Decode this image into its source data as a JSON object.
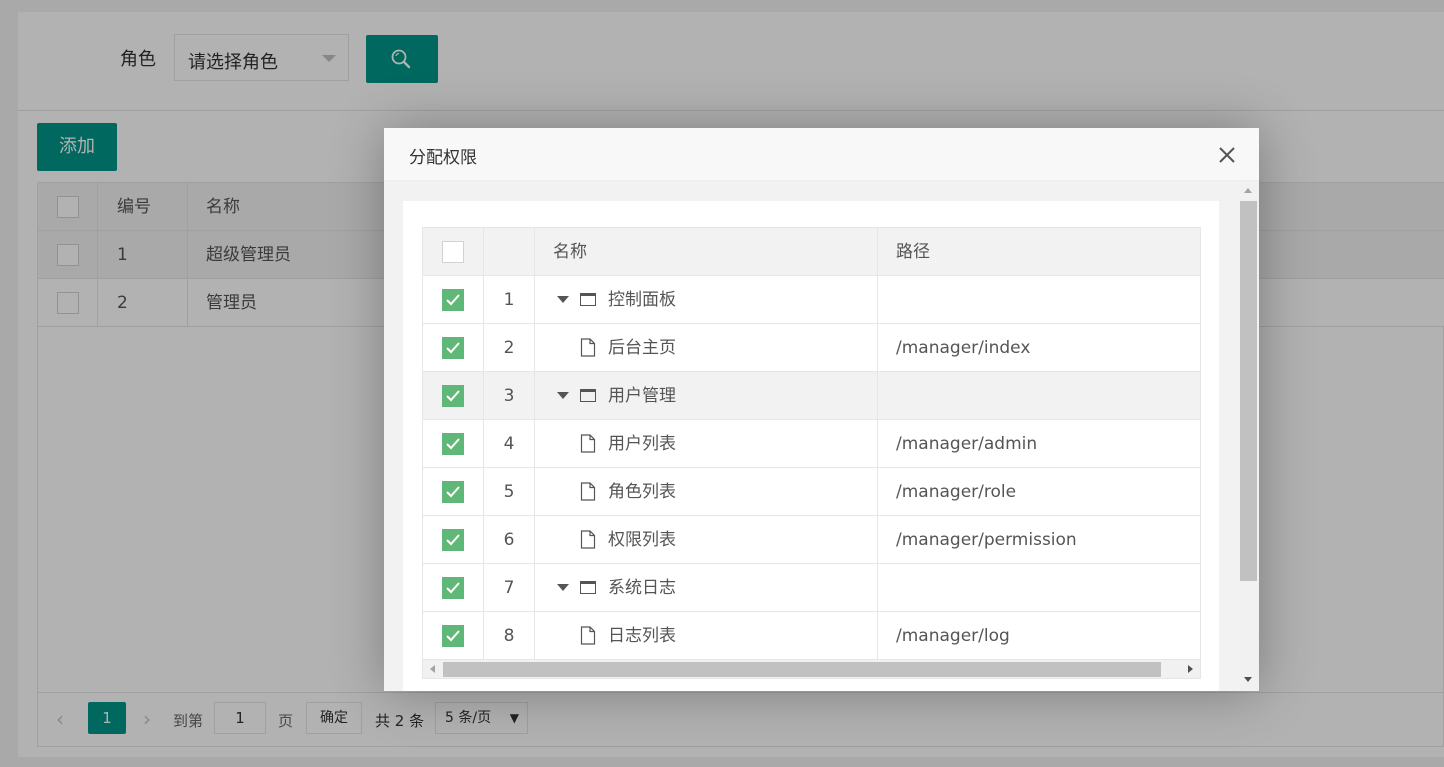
{
  "search": {
    "role_label": "角色",
    "role_select_value": "请选择角色",
    "search_button_icon": "search-icon"
  },
  "toolbar": {
    "add_label": "添加"
  },
  "roles_table": {
    "headers": {
      "number": "编号",
      "name": "名称"
    },
    "rows": [
      {
        "id": "1",
        "name": "超级管理员"
      },
      {
        "id": "2",
        "name": "管理员"
      }
    ]
  },
  "pager": {
    "current_page": "1",
    "goto_label": "到第",
    "page_input": "1",
    "page_unit": "页",
    "confirm_label": "确定",
    "total_text": "共 2 条",
    "page_size": "5 条/页"
  },
  "modal": {
    "title": "分配权限",
    "headers": {
      "name": "名称",
      "path": "路径"
    },
    "rows": [
      {
        "index": "1",
        "name": "控制面板",
        "path": "",
        "type": "folder",
        "checked": true
      },
      {
        "index": "2",
        "name": "后台主页",
        "path": "/manager/index",
        "type": "file",
        "checked": true
      },
      {
        "index": "3",
        "name": "用户管理",
        "path": "",
        "type": "folder",
        "checked": true
      },
      {
        "index": "4",
        "name": "用户列表",
        "path": "/manager/admin",
        "type": "file",
        "checked": true
      },
      {
        "index": "5",
        "name": "角色列表",
        "path": "/manager/role",
        "type": "file",
        "checked": true
      },
      {
        "index": "6",
        "name": "权限列表",
        "path": "/manager/permission",
        "type": "file",
        "checked": true
      },
      {
        "index": "7",
        "name": "系统日志",
        "path": "",
        "type": "folder",
        "checked": true
      },
      {
        "index": "8",
        "name": "日志列表",
        "path": "/manager/log",
        "type": "file",
        "checked": true
      }
    ]
  },
  "colors": {
    "primary": "#009688",
    "checkbox_checked": "#5fb878"
  }
}
